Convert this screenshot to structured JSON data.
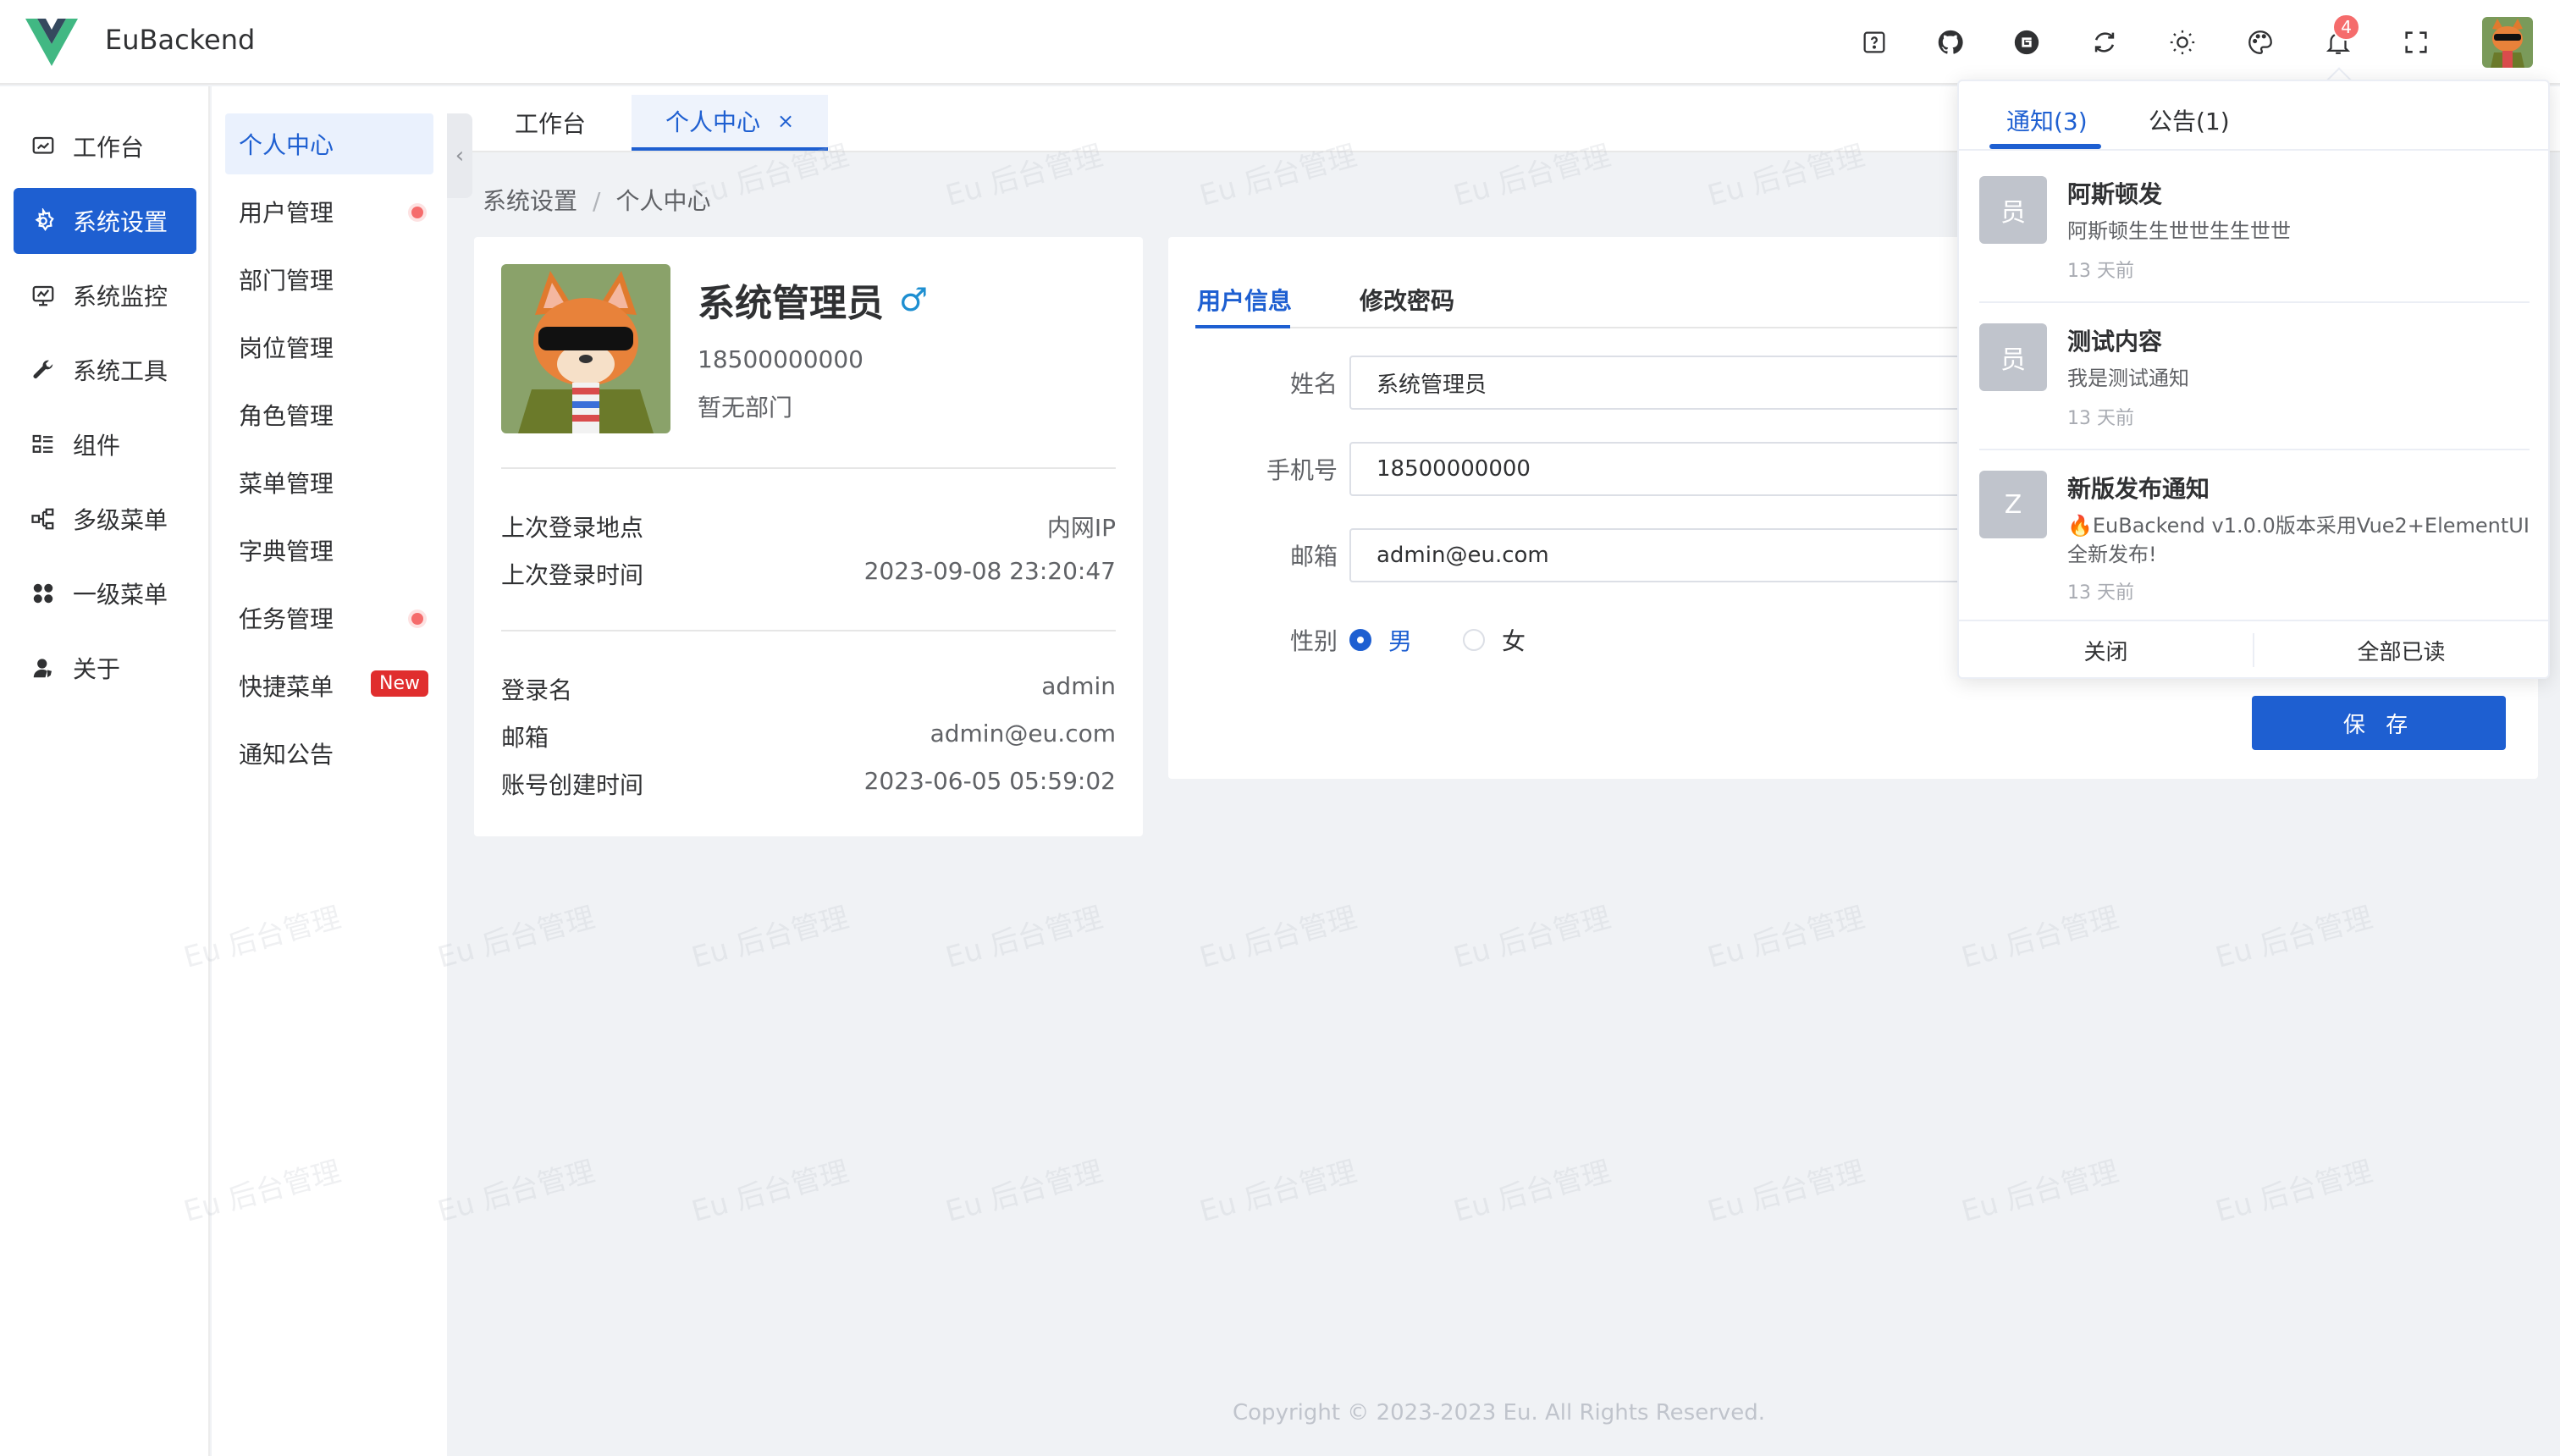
{
  "app": {
    "title": "EuBackend"
  },
  "header": {
    "icons": [
      "help-icon",
      "github-icon",
      "gitee-icon",
      "refresh-icon",
      "theme-sun-icon",
      "palette-icon",
      "bell-icon",
      "fullscreen-icon"
    ],
    "notification_count": "4"
  },
  "menu1": {
    "items": [
      {
        "label": "工作台",
        "icon": "dashboard-icon"
      },
      {
        "label": "系统设置",
        "icon": "settings-icon"
      },
      {
        "label": "系统监控",
        "icon": "monitor-icon"
      },
      {
        "label": "系统工具",
        "icon": "wrench-icon"
      },
      {
        "label": "组件",
        "icon": "components-icon"
      },
      {
        "label": "多级菜单",
        "icon": "tree-icon"
      },
      {
        "label": "一级菜单",
        "icon": "grid-icon"
      },
      {
        "label": "关于",
        "icon": "user-icon"
      }
    ]
  },
  "menu2": {
    "items": [
      {
        "label": "个人中心"
      },
      {
        "label": "用户管理"
      },
      {
        "label": "部门管理"
      },
      {
        "label": "岗位管理"
      },
      {
        "label": "角色管理"
      },
      {
        "label": "菜单管理"
      },
      {
        "label": "字典管理"
      },
      {
        "label": "任务管理"
      },
      {
        "label": "快捷菜单"
      },
      {
        "label": "通知公告"
      }
    ],
    "new_badge": "New"
  },
  "tabs": [
    {
      "label": "工作台"
    },
    {
      "label": "个人中心",
      "close": "×"
    }
  ],
  "breadcrumb": {
    "parent": "系统设置",
    "sep": "/",
    "current": "个人中心"
  },
  "profile": {
    "name": "系统管理员",
    "gender_symbol": "♂",
    "phone": "18500000000",
    "dept": "暂无部门",
    "last_login_location_label": "上次登录地点",
    "last_login_location": "内网IP",
    "last_login_time_label": "上次登录时间",
    "last_login_time": "2023-09-08 23:20:47",
    "username_label": "登录名",
    "username": "admin",
    "email_label": "邮箱",
    "email": "admin@eu.com",
    "created_label": "账号创建时间",
    "created": "2023-06-05 05:59:02"
  },
  "form": {
    "tab_info": "用户信息",
    "tab_password": "修改密码",
    "name_label": "姓名",
    "name_value": "系统管理员",
    "phone_label": "手机号",
    "phone_value": "18500000000",
    "email_label": "邮箱",
    "email_value": "admin@eu.com",
    "gender_label": "性别",
    "gender_male": "男",
    "gender_female": "女",
    "save": "保 存"
  },
  "notifications": {
    "tab_notice": "通知(3)",
    "tab_announce": "公告(1)",
    "items": [
      {
        "avatar": "员",
        "title": "阿斯顿发",
        "desc": "阿斯顿生生世世生生世世",
        "time": "13 天前"
      },
      {
        "avatar": "员",
        "title": "测试内容",
        "desc": "我是测试通知",
        "time": "13 天前"
      },
      {
        "avatar": "Z",
        "title": "新版发布通知",
        "desc": "🔥EuBackend v1.0.0版本采用Vue2+ElementUI全新发布!",
        "time": "13 天前"
      }
    ],
    "close": "关闭",
    "mark_all": "全部已读"
  },
  "watermark": "Eu 后台管理",
  "copyright": "Copyright © 2023-2023 Eu. All Rights Reserved.",
  "colors": {
    "primary": "#1e5fd1",
    "danger": "#f56c6c",
    "bg": "#f0f2f5"
  }
}
